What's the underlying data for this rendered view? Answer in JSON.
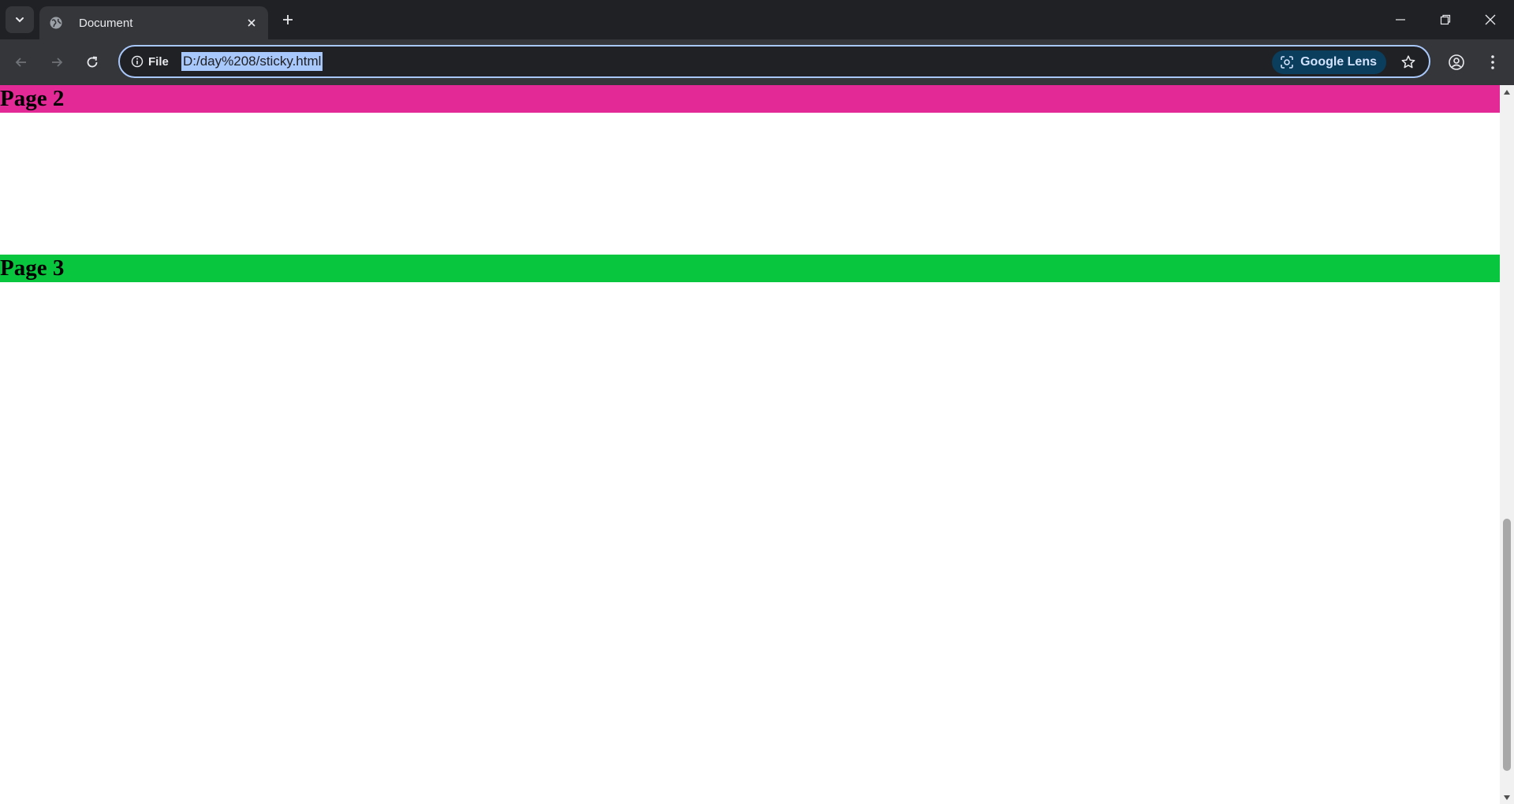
{
  "browser": {
    "tab": {
      "title": "Document"
    },
    "omnibox": {
      "security_label": "File",
      "url": "D:/day%208/sticky.html",
      "lens_label": "Google Lens"
    },
    "icons": {
      "tab_search": "chevron-down-icon",
      "favicon": "globe-icon",
      "close_tab": "close-icon",
      "new_tab": "plus-icon",
      "back": "arrow-left-icon",
      "forward": "arrow-right-icon",
      "reload": "reload-icon",
      "site_info": "info-icon",
      "lens": "lens-icon",
      "bookmark": "star-icon",
      "profile": "profile-icon",
      "menu": "kebab-menu-icon",
      "minimize": "minimize-icon",
      "restore": "restore-icon",
      "close_window": "close-icon"
    }
  },
  "page": {
    "sections": [
      {
        "heading": "Page 2",
        "color": "#e22996"
      },
      {
        "heading": "Page 3",
        "color": "#09c63f"
      }
    ]
  },
  "colors": {
    "chrome_dark": "#202124",
    "toolbar": "#35363a",
    "selection": "#a8c7fa",
    "lens_chip": "#0b3d5c"
  }
}
